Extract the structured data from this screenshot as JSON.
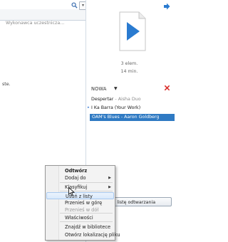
{
  "search": {
    "placeholder": "Wykonawca uczestnicza...",
    "dropdown_glyph": "▾"
  },
  "left_pane": {
    "partial_text": "ste."
  },
  "playlist": {
    "count": "3 elem.",
    "duration": "14 min.",
    "header": "NOWA",
    "header_arrow": "▼",
    "tracks": [
      {
        "title": "Despertar",
        "artist": "Aisha Duo"
      },
      {
        "title": "I Ka Barra (Your Work)",
        "artist": ""
      },
      {
        "title": "OAM's Blues",
        "artist": "Aaron Goldberg"
      }
    ],
    "now_playing_marker": "▸",
    "save_button_label": "pisz listę odtwarzania"
  },
  "context_menu": {
    "items": [
      {
        "label": "Odtwórz",
        "bold": true
      },
      {
        "label": "Dodaj do",
        "submenu": true
      },
      {
        "label": "Klasyfikuj",
        "submenu": true
      },
      {
        "label": "Usuń z listy",
        "highlighted": true
      },
      {
        "label": "Przenieś w górę"
      },
      {
        "label": "Przenieś w dół",
        "disabled": true
      },
      {
        "label": "Właściwości"
      },
      {
        "label": "Znajdź w bibliotece"
      },
      {
        "label": "Otwórz lokalizację pliku"
      }
    ],
    "submenu_glyph": "▶"
  },
  "colors": {
    "accent_blue": "#2f7ac3",
    "play_blue": "#2a7bd0",
    "clear_red": "#d9302c"
  },
  "icons": [
    "search-icon",
    "pane-arrow-icon",
    "play-icon",
    "clear-list-icon",
    "mouse-cursor-icon"
  ]
}
